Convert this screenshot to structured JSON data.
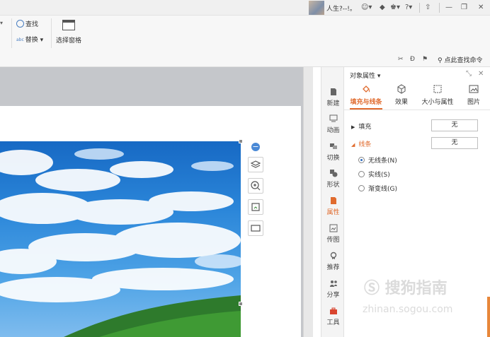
{
  "titlebar": {
    "username": "人生?--!。",
    "window_controls": [
      "minimize",
      "restore",
      "close"
    ]
  },
  "ribbon": {
    "find_label": "查找",
    "replace_label": "替换",
    "selection_pane_label": "选择窗格",
    "search_command_label": "点此查找命令"
  },
  "sidebar": {
    "items": [
      {
        "label": "新建"
      },
      {
        "label": "动画"
      },
      {
        "label": "切换"
      },
      {
        "label": "形状"
      },
      {
        "label": "属性"
      },
      {
        "label": "传图"
      },
      {
        "label": "推荐"
      },
      {
        "label": "分享"
      },
      {
        "label": "工具"
      }
    ],
    "active": "属性"
  },
  "panel": {
    "title": "对象属性",
    "tabs": [
      {
        "label": "填充与线条"
      },
      {
        "label": "效果"
      },
      {
        "label": "大小与属性"
      },
      {
        "label": "图片"
      }
    ],
    "fill": {
      "label": "填充",
      "value": "无"
    },
    "line": {
      "label": "线条",
      "value": "无"
    },
    "line_options": [
      {
        "label": "无线条(N)",
        "checked": true
      },
      {
        "label": "实线(S)",
        "checked": false
      },
      {
        "label": "渐变线(G)",
        "checked": false
      }
    ]
  },
  "watermark": {
    "text": "搜狗指南",
    "url": "zhinan.sogou.com"
  },
  "colors": {
    "accent": "#e06b2e",
    "radio_checked": "#2e6bbd",
    "workspace_bg": "#c5c7cb"
  }
}
